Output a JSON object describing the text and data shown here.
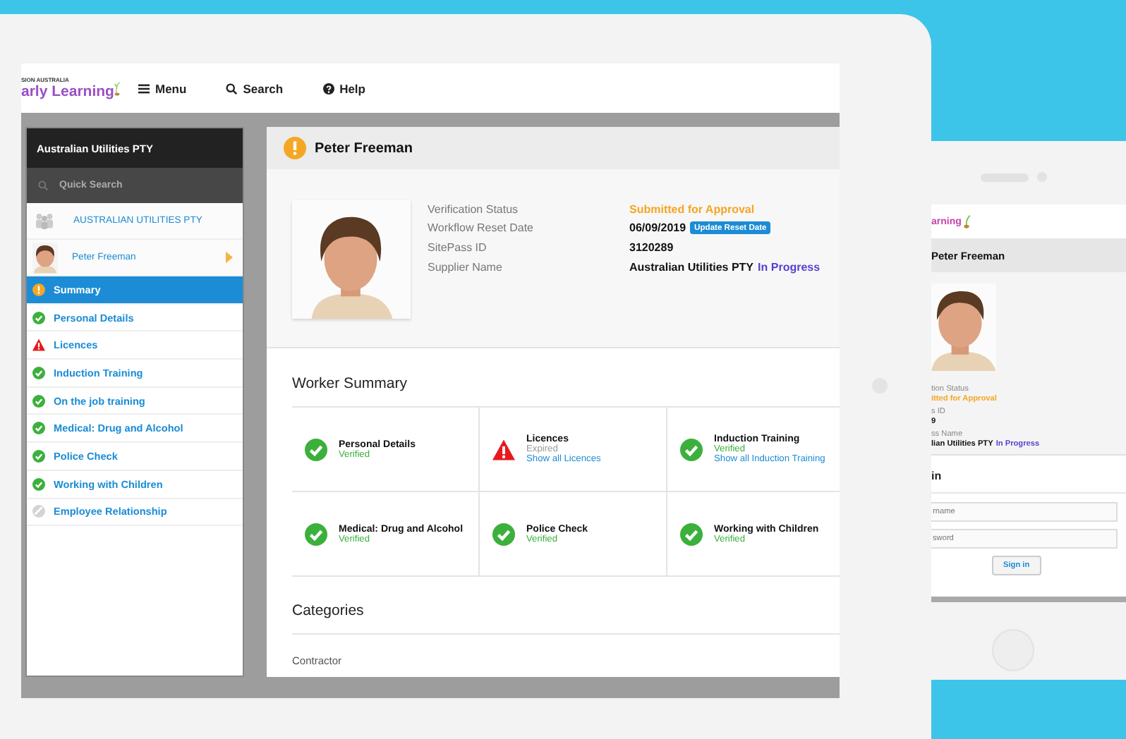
{
  "header": {
    "logo": {
      "tagline": "SION AUSTRALIA",
      "name": "arly Learning"
    },
    "nav": [
      {
        "kind": "menu",
        "label": "Menu"
      },
      {
        "kind": "search",
        "label": "Search"
      },
      {
        "kind": "help",
        "label": "Help"
      }
    ]
  },
  "sidebar": {
    "title": "Australian Utilities PTY",
    "search": {
      "placeholder": "Quick Search"
    },
    "organization": "AUSTRALIAN UTILITIES PTY",
    "person": "Peter Freeman",
    "items": [
      {
        "label": "Summary",
        "kind": "pending",
        "selected": true
      },
      {
        "label": "Personal Details",
        "kind": "verified",
        "selected": false
      },
      {
        "label": "Licences",
        "kind": "alert",
        "selected": false
      },
      {
        "label": "Induction Training",
        "kind": "verified",
        "selected": false
      },
      {
        "label": "On the job training",
        "kind": "verified",
        "selected": false
      },
      {
        "label": "Medical: Drug and Alcohol",
        "kind": "verified",
        "selected": false
      },
      {
        "label": "Police Check",
        "kind": "verified",
        "selected": false
      },
      {
        "label": "Working with Children",
        "kind": "verified",
        "selected": false
      },
      {
        "label": "Employee Relationship",
        "kind": "inactive",
        "selected": false
      }
    ]
  },
  "profile": {
    "name": "Peter Freeman",
    "kind": "pending",
    "fields": [
      {
        "label": "Verification Status",
        "value": "Submitted for Approval",
        "kind": "status"
      },
      {
        "label": "Workflow Reset Date",
        "value": "06/09/2019",
        "kind": "date",
        "action": "Update Reset Date"
      },
      {
        "label": "SitePass ID",
        "value": "3120289",
        "kind": "plain"
      },
      {
        "label": "Supplier Name",
        "value": "Australian Utilities PTY",
        "kind": "supplier",
        "badge": "In Progress"
      }
    ]
  },
  "worker_summary": {
    "title": "Worker Summary",
    "cards": [
      {
        "title": "Personal Details",
        "kind": "verified",
        "state": "Verified"
      },
      {
        "title": "Licences",
        "kind": "alert",
        "state": "Expired",
        "link": "Show all Licences"
      },
      {
        "title": "Induction Training",
        "kind": "verified",
        "state": "Verified",
        "link": "Show all Induction Training"
      },
      {
        "title": "Medical: Drug and Alcohol",
        "kind": "verified",
        "state": "Verified"
      },
      {
        "title": "Police Check",
        "kind": "verified",
        "state": "Verified"
      },
      {
        "title": "Working with Children",
        "kind": "verified",
        "state": "Verified"
      }
    ]
  },
  "categories": {
    "title": "Categories",
    "items": [
      "Contractor"
    ]
  },
  "second_device": {
    "logo": "arning",
    "name": "Peter Freeman",
    "fields": [
      {
        "label": "tion Status",
        "value": "itted for Approval",
        "kind": "status"
      },
      {
        "label": "s ID",
        "value": "9",
        "kind": "plain"
      },
      {
        "label": "ss Name",
        "value": "lian Utilities PTY",
        "kind": "supplier",
        "badge": "In Progress"
      }
    ],
    "signin": {
      "title": "in",
      "username_placeholder": "rname",
      "password_placeholder": "sword",
      "button": "Sign in"
    }
  }
}
